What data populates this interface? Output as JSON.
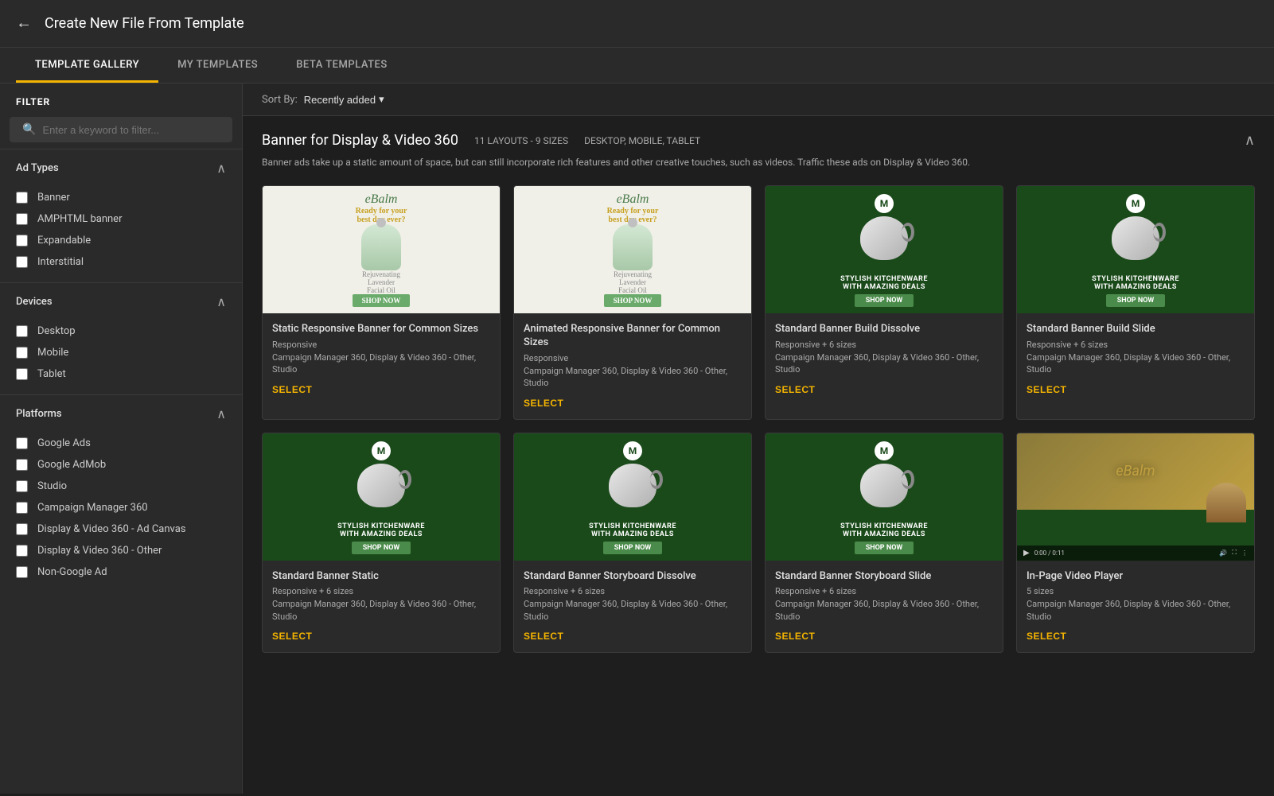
{
  "header": {
    "back_label": "←",
    "title": "Create New File From Template"
  },
  "tabs": [
    {
      "id": "template-gallery",
      "label": "TEMPLATE GALLERY",
      "active": true
    },
    {
      "id": "my-templates",
      "label": "MY TEMPLATES",
      "active": false
    },
    {
      "id": "beta-templates",
      "label": "BETA TEMPLATES",
      "active": false
    }
  ],
  "filter": {
    "header": "FILTER",
    "search_placeholder": "Enter a keyword to filter..."
  },
  "ad_types": {
    "label": "Ad Types",
    "items": [
      {
        "label": "Banner",
        "checked": false
      },
      {
        "label": "AMPHTML banner",
        "checked": false
      },
      {
        "label": "Expandable",
        "checked": false
      },
      {
        "label": "Interstitial",
        "checked": false
      }
    ]
  },
  "devices": {
    "label": "Devices",
    "items": [
      {
        "label": "Desktop",
        "checked": false
      },
      {
        "label": "Mobile",
        "checked": false
      },
      {
        "label": "Tablet",
        "checked": false
      }
    ]
  },
  "platforms": {
    "label": "Platforms",
    "items": [
      {
        "label": "Google Ads",
        "checked": false
      },
      {
        "label": "Google AdMob",
        "checked": false
      },
      {
        "label": "Studio",
        "checked": false
      },
      {
        "label": "Campaign Manager 360",
        "checked": false
      },
      {
        "label": "Display & Video 360 - Ad Canvas",
        "checked": false
      },
      {
        "label": "Display & Video 360 - Other",
        "checked": false
      },
      {
        "label": "Non-Google Ad",
        "checked": false
      }
    ]
  },
  "sort_bar": {
    "label": "Sort By:",
    "selected": "Recently added"
  },
  "banner_section": {
    "title": "Banner for Display & Video 360",
    "layouts": "11 LAYOUTS - 9 SIZES",
    "platforms": "DESKTOP, MOBILE, TABLET",
    "description": "Banner ads take up a static amount of space, but can still incorporate rich features and other creative touches, such as videos. Traffic these ads on Display & Video 360."
  },
  "templates": [
    {
      "id": "static-responsive",
      "name": "Static Responsive Banner for Common Sizes",
      "responsive": "Responsive",
      "platforms": "Campaign Manager 360, Display & Video 360 - Other, Studio",
      "ad_type": "ebalm",
      "select_label": "SELECT"
    },
    {
      "id": "animated-responsive",
      "name": "Animated Responsive Banner for Common Sizes",
      "responsive": "Responsive",
      "platforms": "Campaign Manager 360, Display & Video 360 - Other, Studio",
      "ad_type": "ebalm",
      "select_label": "SELECT"
    },
    {
      "id": "standard-dissolve",
      "name": "Standard Banner Build Dissolve",
      "responsive": "Responsive + 6 sizes",
      "platforms": "Campaign Manager 360, Display & Video 360 - Other, Studio",
      "ad_type": "kettle",
      "select_label": "SELECT"
    },
    {
      "id": "standard-slide",
      "name": "Standard Banner Build Slide",
      "responsive": "Responsive + 6 sizes",
      "platforms": "Campaign Manager 360, Display & Video 360 - Other, Studio",
      "ad_type": "kettle",
      "select_label": "SELECT"
    },
    {
      "id": "standard-static",
      "name": "Standard Banner Static",
      "responsive": "Responsive + 6 sizes",
      "platforms": "Campaign Manager 360, Display & Video 360 - Other, Studio",
      "ad_type": "kettle",
      "select_label": "SELECT"
    },
    {
      "id": "storyboard-dissolve",
      "name": "Standard Banner Storyboard Dissolve",
      "responsive": "Responsive + 6 sizes",
      "platforms": "Campaign Manager 360, Display & Video 360 - Other, Studio",
      "ad_type": "kettle",
      "select_label": "SELECT"
    },
    {
      "id": "storyboard-slide",
      "name": "Standard Banner Storyboard Slide",
      "responsive": "Responsive + 6 sizes",
      "platforms": "Campaign Manager 360, Display & Video 360 - Other, Studio",
      "ad_type": "kettle",
      "select_label": "SELECT"
    },
    {
      "id": "in-page-video",
      "name": "In-Page Video Player",
      "responsive": "5 sizes",
      "platforms": "Campaign Manager 360, Display & Video 360 - Other, Studio",
      "ad_type": "video",
      "select_label": "SELECT"
    }
  ]
}
